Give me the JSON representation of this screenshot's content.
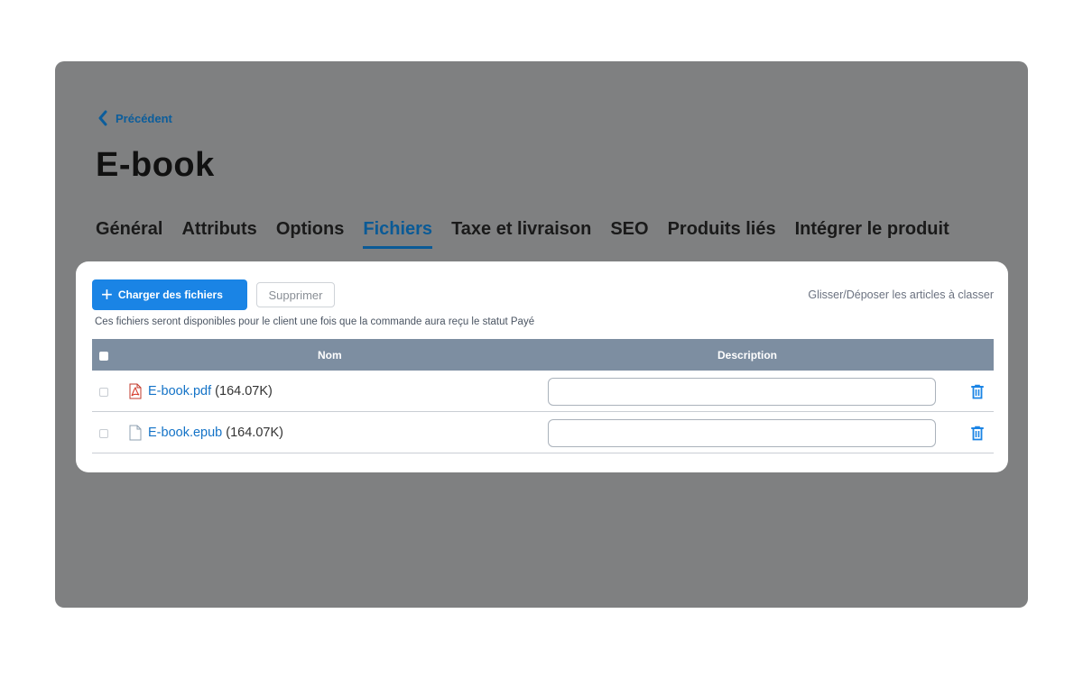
{
  "nav": {
    "back_label": "Précédent"
  },
  "page": {
    "title": "E-book"
  },
  "tabs": [
    {
      "label": "Général"
    },
    {
      "label": "Attributs"
    },
    {
      "label": "Options"
    },
    {
      "label": "Fichiers",
      "active": true
    },
    {
      "label": "Taxe et livraison"
    },
    {
      "label": "SEO"
    },
    {
      "label": "Produits liés"
    },
    {
      "label": "Intégrer le produit"
    }
  ],
  "toolbar": {
    "upload_label": "Charger des fichiers",
    "delete_label": "Supprimer",
    "drag_hint": "Glisser/Déposer les articles à classer"
  },
  "info_text": "Ces fichiers seront disponibles pour le client une fois que la commande aura reçu le statut Payé",
  "table": {
    "columns": {
      "name": "Nom",
      "description": "Description"
    },
    "rows": [
      {
        "filename": "E-book.pdf",
        "size": "(164.07K)",
        "icon": "pdf-file-icon",
        "description": ""
      },
      {
        "filename": "E-book.epub",
        "size": "(164.07K)",
        "icon": "generic-file-icon",
        "description": ""
      }
    ]
  },
  "colors": {
    "accent": "#1a84e5",
    "active_tab": "#0a5a96",
    "table_header": "#7d8ea1",
    "overlay": "#7f8081",
    "link": "#1473c7"
  }
}
